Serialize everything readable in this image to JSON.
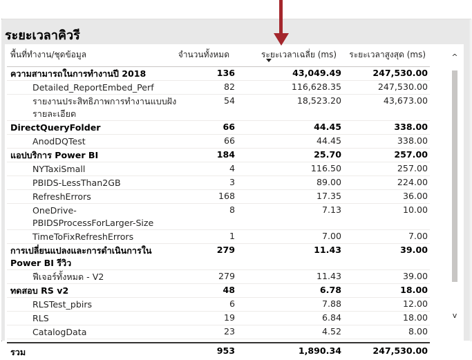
{
  "visual": {
    "title": "ระยะเวลาคิวรี"
  },
  "table": {
    "columns": {
      "name": "พื้นที่ทำงาน/ชุดข้อมูล",
      "count": "จำนวนทั้งหมด",
      "avg": "ระยะเวลาเฉลี่ย (ms)",
      "max": "ระยะเวลาสูงสุด (ms)"
    },
    "sorted_column": "avg",
    "sort_direction": "descending",
    "rows": [
      {
        "level": 0,
        "name": "ความสามารถในการทำงานปี 2018",
        "count": "136",
        "avg": "43,049.49",
        "max": "247,530.00"
      },
      {
        "level": 1,
        "name": "Detailed_ReportEmbed_Perf",
        "count": "82",
        "avg": "116,628.35",
        "max": "247,530.00"
      },
      {
        "level": 1,
        "name": "รายงานประสิทธิภาพการทำงานแบบฝังรายละเอียด",
        "count": "54",
        "avg": "18,523.20",
        "max": "43,673.00"
      },
      {
        "level": 0,
        "name": "DirectQueryFolder",
        "count": "66",
        "avg": "44.45",
        "max": "338.00"
      },
      {
        "level": 1,
        "name": "AnodDQTest",
        "count": "66",
        "avg": "44.45",
        "max": "338.00"
      },
      {
        "level": 0,
        "name": "แอปบริการ Power BI",
        "count": "184",
        "avg": "25.70",
        "max": "257.00"
      },
      {
        "level": 1,
        "name": "NYTaxiSmall",
        "count": "4",
        "avg": "116.50",
        "max": "257.00"
      },
      {
        "level": 1,
        "name": "PBIDS-LessThan2GB",
        "count": "3",
        "avg": "89.00",
        "max": "224.00"
      },
      {
        "level": 1,
        "name": "RefreshErrors",
        "count": "168",
        "avg": "17.35",
        "max": "36.00"
      },
      {
        "level": 1,
        "name": "OneDrive-PBIDSProcessForLarger-Size",
        "count": "8",
        "avg": "7.13",
        "max": "10.00"
      },
      {
        "level": 1,
        "name": "TimeToFixRefreshErrors",
        "count": "1",
        "avg": "7.00",
        "max": "7.00"
      },
      {
        "level": 0,
        "name": "การเปลี่ยนแปลงและการดำเนินการใน Power BI รีวิว",
        "count": "279",
        "avg": "11.43",
        "max": "39.00"
      },
      {
        "level": 1,
        "name": "ฟีเจอร์ทั้งหมด - V2",
        "count": "279",
        "avg": "11.43",
        "max": "39.00"
      },
      {
        "level": 0,
        "name": "ทดสอบ RS v2",
        "count": "48",
        "avg": "6.78",
        "max": "18.00"
      },
      {
        "level": 1,
        "name": "RLSTest_pbirs",
        "count": "6",
        "avg": "7.88",
        "max": "12.00"
      },
      {
        "level": 1,
        "name": "RLS",
        "count": "19",
        "avg": "6.84",
        "max": "18.00"
      },
      {
        "level": 1,
        "name": "CatalogData",
        "count": "23",
        "avg": "4.52",
        "max": "8.00"
      }
    ],
    "total": {
      "name": "รวม",
      "count": "953",
      "avg": "1,890.34",
      "max": "247,530.00"
    }
  },
  "scrollbar": {
    "up_glyph": "^",
    "down_glyph": "v"
  },
  "annotation_color": "#a4262c"
}
